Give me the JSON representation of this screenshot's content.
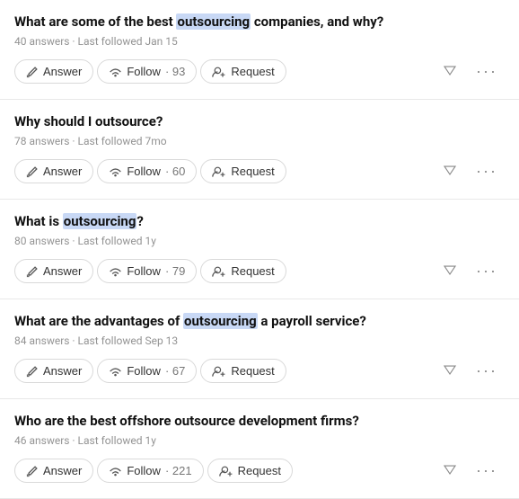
{
  "questions": [
    {
      "id": "q1",
      "title_parts": [
        {
          "text": "What are some of the best ",
          "highlight": false
        },
        {
          "text": "outsourcing",
          "highlight": true
        },
        {
          "text": " companies, and why?",
          "highlight": false
        }
      ],
      "title_full": "What are some of the best outsourcing companies, and why?",
      "answers": "40 answers",
      "last_followed": "Last followed Jan 15",
      "follow_count": "93",
      "answer_label": "Answer",
      "follow_label": "Follow",
      "request_label": "Request"
    },
    {
      "id": "q2",
      "title_parts": [
        {
          "text": "Why should I outsource?",
          "highlight": false
        }
      ],
      "title_full": "Why should I outsource?",
      "answers": "78 answers",
      "last_followed": "Last followed 7mo",
      "follow_count": "60",
      "answer_label": "Answer",
      "follow_label": "Follow",
      "request_label": "Request"
    },
    {
      "id": "q3",
      "title_parts": [
        {
          "text": "What is ",
          "highlight": false
        },
        {
          "text": "outsourcing",
          "highlight": true
        },
        {
          "text": "?",
          "highlight": false
        }
      ],
      "title_full": "What is outsourcing?",
      "answers": "80 answers",
      "last_followed": "Last followed 1y",
      "follow_count": "79",
      "answer_label": "Answer",
      "follow_label": "Follow",
      "request_label": "Request"
    },
    {
      "id": "q4",
      "title_parts": [
        {
          "text": "What are the advantages of ",
          "highlight": false
        },
        {
          "text": "outsourcing",
          "highlight": true
        },
        {
          "text": " a payroll service?",
          "highlight": false
        }
      ],
      "title_full": "What are the advantages of outsourcing a payroll service?",
      "answers": "84 answers",
      "last_followed": "Last followed Sep 13",
      "follow_count": "67",
      "answer_label": "Answer",
      "follow_label": "Follow",
      "request_label": "Request"
    },
    {
      "id": "q5",
      "title_parts": [
        {
          "text": "Who are the best offshore outsource development firms?",
          "highlight": false
        }
      ],
      "title_full": "Who are the best offshore outsource development firms?",
      "answers": "46 answers",
      "last_followed": "Last followed 1y",
      "follow_count": "221",
      "answer_label": "Answer",
      "follow_label": "Follow",
      "request_label": "Request"
    }
  ]
}
